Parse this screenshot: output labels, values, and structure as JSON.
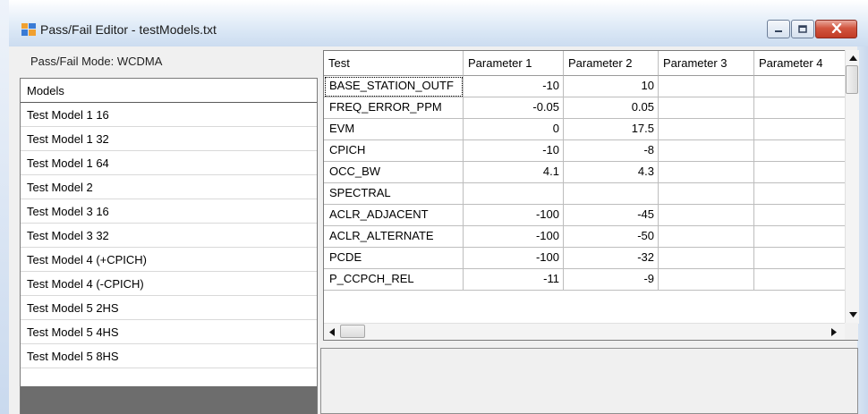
{
  "window": {
    "title": "Pass/Fail Editor - testModels.txt",
    "accent": "#cddcef",
    "close_color": "#c8432b"
  },
  "left_panel": {
    "mode_label": "Pass/Fail Mode:  WCDMA",
    "list_header": "Models",
    "models": [
      "Test Model 1 16",
      "Test Model 1 32",
      "Test Model 1 64",
      "Test Model 2",
      "Test Model 3 16",
      "Test Model 3 32",
      "Test Model 4 (+CPICH)",
      "Test Model 4 (-CPICH)",
      "Test Model 5 2HS",
      "Test Model 5 4HS",
      "Test Model 5 8HS"
    ]
  },
  "grid": {
    "columns": [
      "Test",
      "Parameter 1",
      "Parameter 2",
      "Parameter 3",
      "Parameter 4"
    ],
    "rows": [
      [
        "BASE_STATION_OUTF",
        "-10",
        "10",
        "",
        ""
      ],
      [
        "FREQ_ERROR_PPM",
        "-0.05",
        "0.05",
        "",
        ""
      ],
      [
        "EVM",
        "0",
        "17.5",
        "",
        ""
      ],
      [
        "CPICH",
        "-10",
        "-8",
        "",
        ""
      ],
      [
        "OCC_BW",
        "4.1",
        "4.3",
        "",
        ""
      ],
      [
        "SPECTRAL",
        "",
        "",
        "",
        ""
      ],
      [
        "ACLR_ADJACENT",
        "-100",
        "-45",
        "",
        ""
      ],
      [
        "ACLR_ALTERNATE",
        "-100",
        "-50",
        "",
        ""
      ],
      [
        "PCDE",
        "-100",
        "-32",
        "",
        ""
      ],
      [
        "P_CCPCH_REL",
        "-11",
        "-9",
        "",
        ""
      ]
    ]
  },
  "icons": {
    "app": "app-window-icon",
    "minimize": "minimize-icon",
    "maximize": "maximize-icon",
    "close": "close-icon",
    "scroll_up": "arrow-up-icon",
    "scroll_down": "arrow-down-icon",
    "scroll_left": "arrow-left-icon",
    "scroll_right": "arrow-right-icon"
  }
}
